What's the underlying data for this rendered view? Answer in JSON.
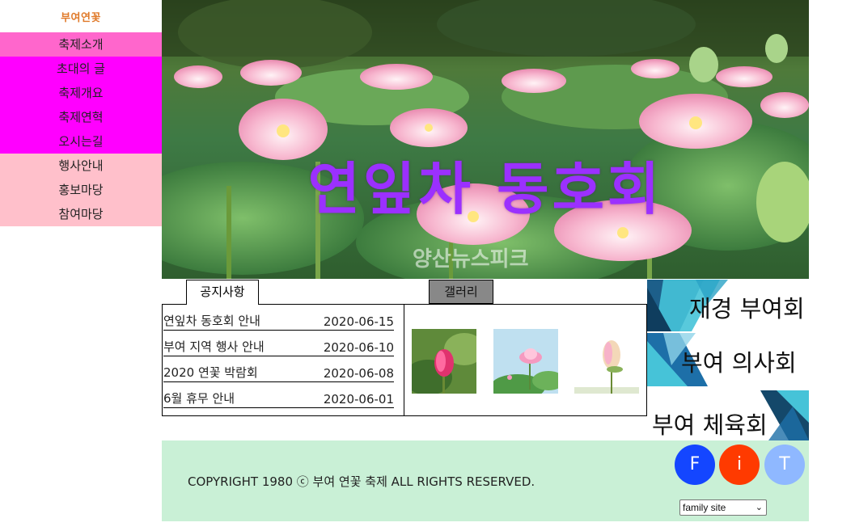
{
  "logo": {
    "text": "부여연꽃"
  },
  "nav": {
    "top": "축제소개",
    "sub": [
      "초대의 글",
      "축제개요",
      "축제연혁",
      "오시는길"
    ],
    "main": [
      "행사안내",
      "홍보마당",
      "참여마당"
    ]
  },
  "hero": {
    "title": "연잎차 동호회",
    "watermark": "양산뉴스피크"
  },
  "tabs": {
    "notice": "공지사항",
    "gallery": "갤러리"
  },
  "notices": [
    {
      "title": "연잎차 동호회 안내",
      "date": "2020-06-15"
    },
    {
      "title": "부여 지역 행사 안내",
      "date": "2020-06-10"
    },
    {
      "title": "2020 연꽃 박람회",
      "date": "2020-06-08"
    },
    {
      "title": "6월 휴무 안내",
      "date": "2020-06-01"
    }
  ],
  "banners": [
    "재경 부여회",
    "부여 의사회",
    "부여 체육회"
  ],
  "footer": {
    "copyright": "COPYRIGHT 1980 ⓒ 부여 연꽃 축제 ALL RIGHTS RESERVED.",
    "sns": [
      {
        "label": "F",
        "color": "#1446ff"
      },
      {
        "label": "i",
        "color": "#ff3a00"
      },
      {
        "label": "T",
        "color": "#8fb8ff"
      }
    ],
    "family_site": "family site"
  }
}
